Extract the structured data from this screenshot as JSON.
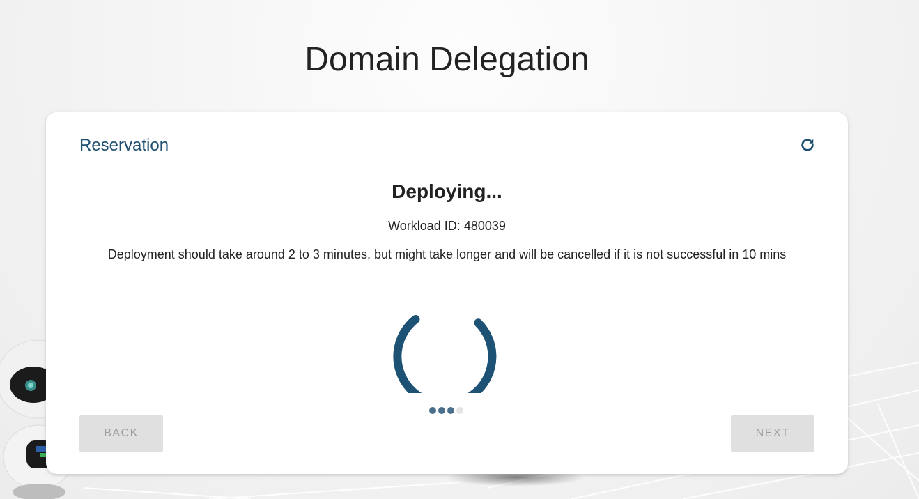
{
  "page": {
    "title": "Domain Delegation"
  },
  "card": {
    "title": "Reservation",
    "refresh_icon": "refresh-icon"
  },
  "deployment": {
    "status": "Deploying...",
    "workload_id": "Workload ID: 480039",
    "notice": "Deployment should take around 2 to 3 minutes, but might take longer and will be cancelled if it is not successful in 10 mins"
  },
  "stepper": {
    "total_steps": 4,
    "active_steps": 3
  },
  "buttons": {
    "back_label": "Back",
    "next_label": "Next",
    "back_disabled": true,
    "next_disabled": true
  },
  "colors": {
    "accent": "#1f5072",
    "spinner": "#1d5275",
    "button_bg_disabled": "#e0e0e0",
    "button_text_disabled": "#9e9e9e"
  }
}
